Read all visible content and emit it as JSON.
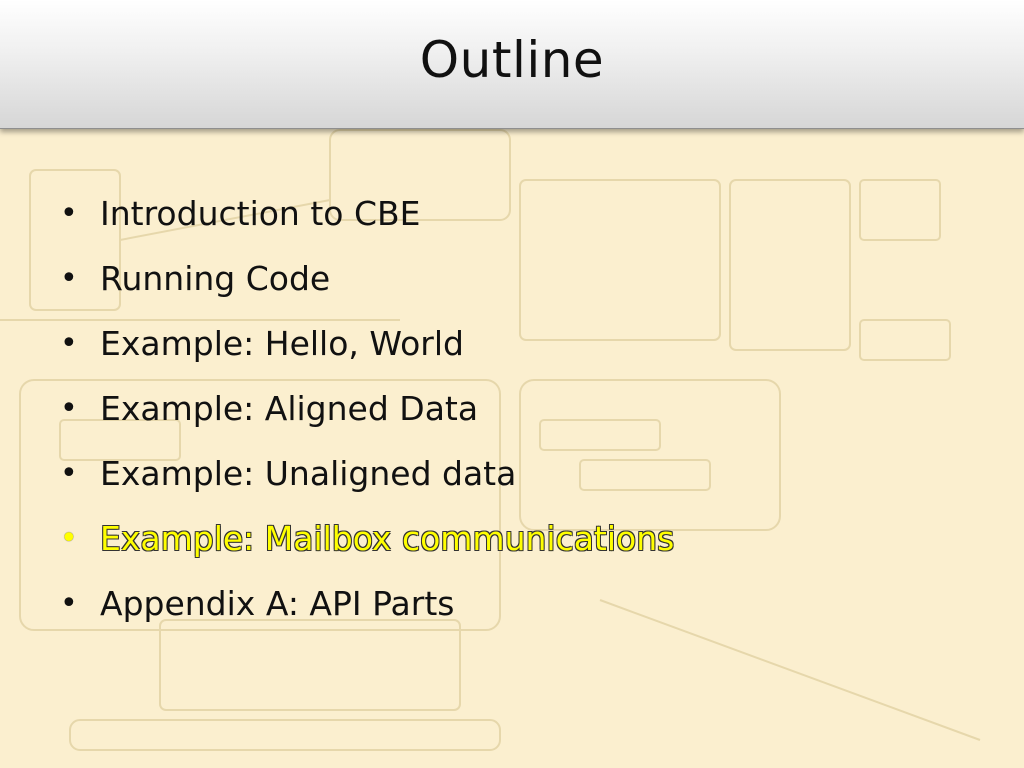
{
  "slide": {
    "title": "Outline",
    "bullets": [
      {
        "text": "Introduction to CBE",
        "highlighted": false
      },
      {
        "text": "Running Code",
        "highlighted": false
      },
      {
        "text": "Example: Hello, World",
        "highlighted": false
      },
      {
        "text": "Example: Aligned Data",
        "highlighted": false
      },
      {
        "text": "Example: Unaligned data",
        "highlighted": false
      },
      {
        "text": "Example: Mailbox communications",
        "highlighted": true
      },
      {
        "text": "Appendix A: API Parts",
        "highlighted": false
      }
    ]
  },
  "colors": {
    "background": "#fbefcf",
    "highlight": "#ffff00",
    "text": "#111111"
  }
}
